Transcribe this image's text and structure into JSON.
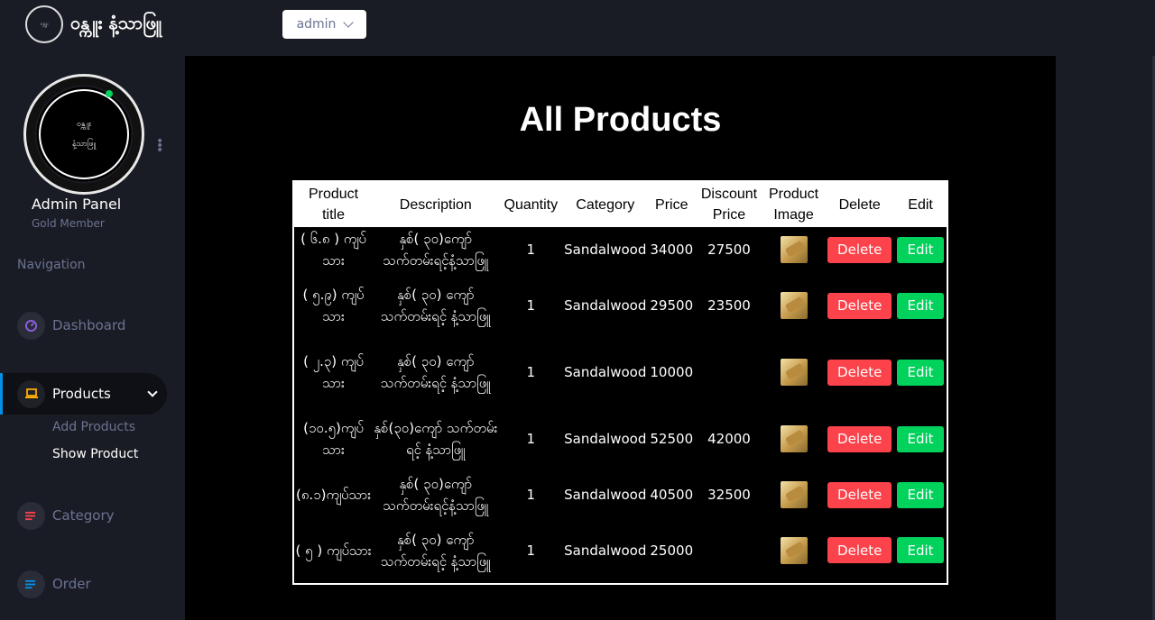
{
  "brand": {
    "logo_text": "ဝန္ကူး",
    "name": "ဝန္ကူး နံ့သာဖြူ"
  },
  "user_menu": {
    "label": "admin"
  },
  "sidebar": {
    "profile": {
      "logo_line1": "ဝန္ကူး",
      "logo_line2": "နံ့သာဖြူ",
      "name": "Admin Panel",
      "membership": "Gold Member"
    },
    "nav_heading": "Navigation",
    "items": [
      {
        "label": "Dashboard",
        "icon": "speedometer-icon",
        "color": "#8f5fe8"
      },
      {
        "label": "Products",
        "icon": "laptop-icon",
        "color": "#ffab00",
        "subitems": [
          {
            "label": "Add Products"
          },
          {
            "label": "Show Product"
          }
        ]
      },
      {
        "label": "Category",
        "icon": "list-icon",
        "color": "#fc424a"
      },
      {
        "label": "Order",
        "icon": "order-icon",
        "color": "#0090e7"
      }
    ]
  },
  "main": {
    "title": "All Products",
    "columns": [
      "Product title",
      "Description",
      "Quantity",
      "Category",
      "Price",
      "Discount Price",
      "Product Image",
      "Delete",
      "Edit"
    ],
    "delete_label": "Delete",
    "edit_label": "Edit",
    "rows": [
      {
        "title": "( ၆.၈ ) ကျပ်သား",
        "description": "နှစ်( ၃၀)ကျော် သက်တမ်းရင့်နံ့သာဖြူ",
        "quantity": "1",
        "category": "Sandalwood",
        "price": "34000",
        "discount": "27500"
      },
      {
        "title": "( ၅.၉) ကျပ်သား",
        "description": "နှစ်( ၃၀) ကျော် သက်တမ်းရင့် နံ့သာဖြူ",
        "quantity": "1",
        "category": "Sandalwood",
        "price": "29500",
        "discount": "23500"
      },
      {
        "title": "( ၂.၃) ကျပ်သား",
        "description": "နှစ်( ၃၀) ကျော် သက်တမ်းရင့် နံ့သာဖြူ",
        "quantity": "1",
        "category": "Sandalwood",
        "price": "10000",
        "discount": ""
      },
      {
        "title": "(၁၀.၅)ကျပ်သား",
        "description": "နှစ်(၃၀)ကျော် သက်တမ်းရင့် နံ့သာဖြူ",
        "quantity": "1",
        "category": "Sandalwood",
        "price": "52500",
        "discount": "42000"
      },
      {
        "title": "(၈.၁)ကျပ်သား",
        "description": "နှစ်( ၃၀)ကျော် သက်တမ်းရင့်နံ့သာဖြူ",
        "quantity": "1",
        "category": "Sandalwood",
        "price": "40500",
        "discount": "32500"
      },
      {
        "title": "( ၅ ) ကျပ်သား",
        "description": "နှစ်( ၃၀) ကျော် သက်တမ်းရင့် နံ့သာဖြူ",
        "quantity": "1",
        "category": "Sandalwood",
        "price": "25000",
        "discount": ""
      }
    ]
  }
}
